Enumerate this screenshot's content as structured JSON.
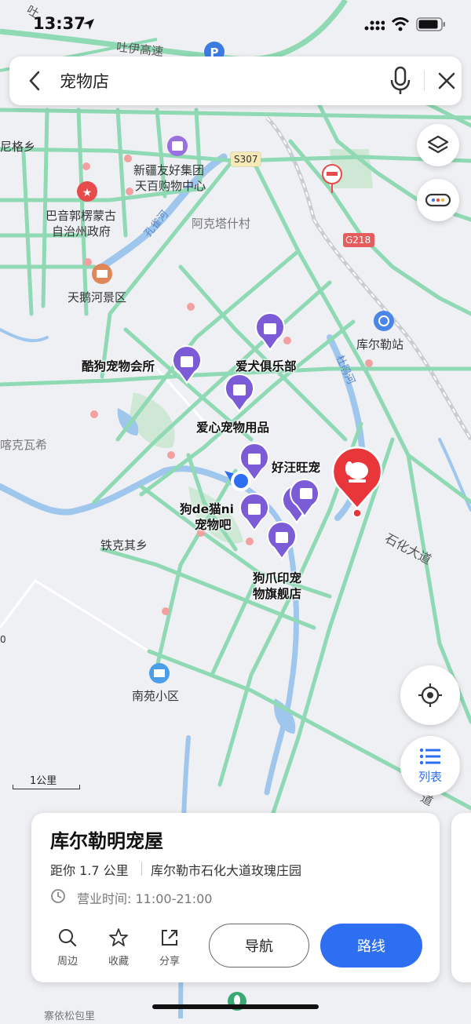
{
  "status_bar": {
    "time": "13:37"
  },
  "search": {
    "query": "宠物店"
  },
  "map": {
    "labels": {
      "tuyi_highway": "吐伊高速",
      "tu": "吐",
      "gexiang": "尼格乡",
      "xinjiang_youhao": "新疆友好集团",
      "tianbai": "天百购物中心",
      "s307": "S307",
      "bayin_1": "巴音郭楞蒙古",
      "bayin_2": "自治州政府",
      "kongque_river": "孔雀河",
      "aketashi": "阿克塔什村",
      "g218": "G218",
      "tiane": "天鹅河景区",
      "korla_station": "库尔勒站",
      "dushan_river": "杜鹃河",
      "kuwagou": "酷狗宠物会所",
      "aiquan": "爱犬俱乐部",
      "aixin": "爱心宠物用品",
      "kawaxi": "喀克瓦希",
      "haowang": "好汪旺宠",
      "gou_de_mao_1": "狗de猫ni",
      "gou_de_mao_2": "宠物吧",
      "shihua_road": "石化大道",
      "tiekeqi": "铁克其乡",
      "gouzhua_1": "狗爪印宠",
      "gouzhua_2": "物旗舰店",
      "nanyuan": "南苑小区",
      "dao": "道",
      "zero": "0",
      "bottom_partial": "寨依松包里"
    },
    "scale": "1公里"
  },
  "controls": {
    "list_label": "列表"
  },
  "place_card": {
    "name": "库尔勒明宠屋",
    "distance": "距你 1.7 公里",
    "address": "库尔勒市石化大道玫瑰庄园",
    "hours": "营业时间: 11:00-21:00",
    "actions": {
      "nearby": "周边",
      "favorite": "收藏",
      "share": "分享"
    },
    "nav_label": "导航",
    "route_label": "路线"
  },
  "colors": {
    "road": "#8fd9b4",
    "water": "#9fc6ec",
    "poi_purple": "#7b5bd6",
    "selected_red": "#e8363b",
    "primary_blue": "#2e6ff2"
  }
}
